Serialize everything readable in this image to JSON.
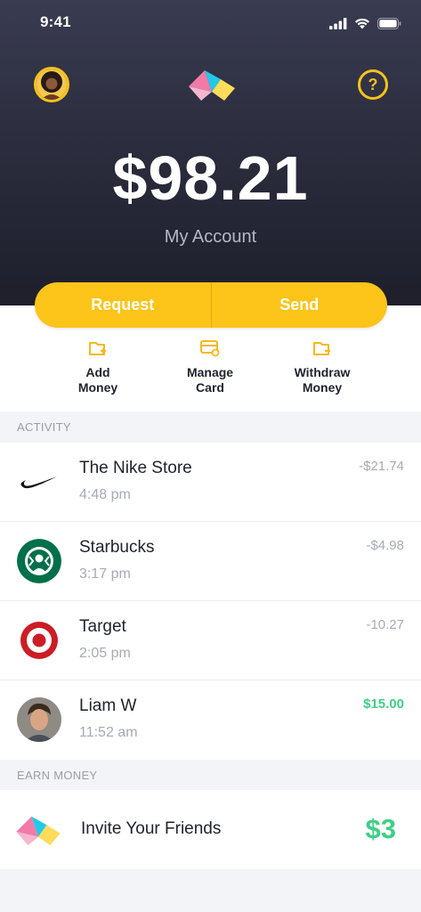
{
  "status_bar": {
    "time": "9:41",
    "icons": [
      "signal-icon",
      "wifi-icon",
      "battery-icon"
    ]
  },
  "header": {
    "balance": "$98.21",
    "account_label": "My Account",
    "help_label": "?"
  },
  "actions": {
    "request_label": "Request",
    "send_label": "Send"
  },
  "quick_actions": [
    {
      "label_1": "Add",
      "label_2": "Money",
      "icon": "add-money-icon"
    },
    {
      "label_1": "Manage",
      "label_2": "Card",
      "icon": "manage-card-icon"
    },
    {
      "label_1": "Withdraw",
      "label_2": "Money",
      "icon": "withdraw-money-icon"
    }
  ],
  "activity": {
    "header": "ACTIVITY",
    "items": [
      {
        "name": "The Nike Store",
        "time": "4:48 pm",
        "amount": "-$21.74",
        "icon": "nike-logo-icon"
      },
      {
        "name": "Starbucks",
        "time": "3:17 pm",
        "amount": "-$4.98",
        "icon": "starbucks-logo-icon"
      },
      {
        "name": "Target",
        "time": "2:05 pm",
        "amount": "-10.27",
        "icon": "target-logo-icon"
      },
      {
        "name": "Liam W",
        "time": "11:52 am",
        "amount": "$15.00",
        "icon": "liam-avatar"
      }
    ]
  },
  "earn": {
    "header": "EARN MONEY",
    "invite_label": "Invite Your Friends",
    "reward": "$3"
  },
  "colors": {
    "accent": "#fdc41a",
    "positive": "#3fcf86",
    "header_dark": "#2c2d3e"
  }
}
